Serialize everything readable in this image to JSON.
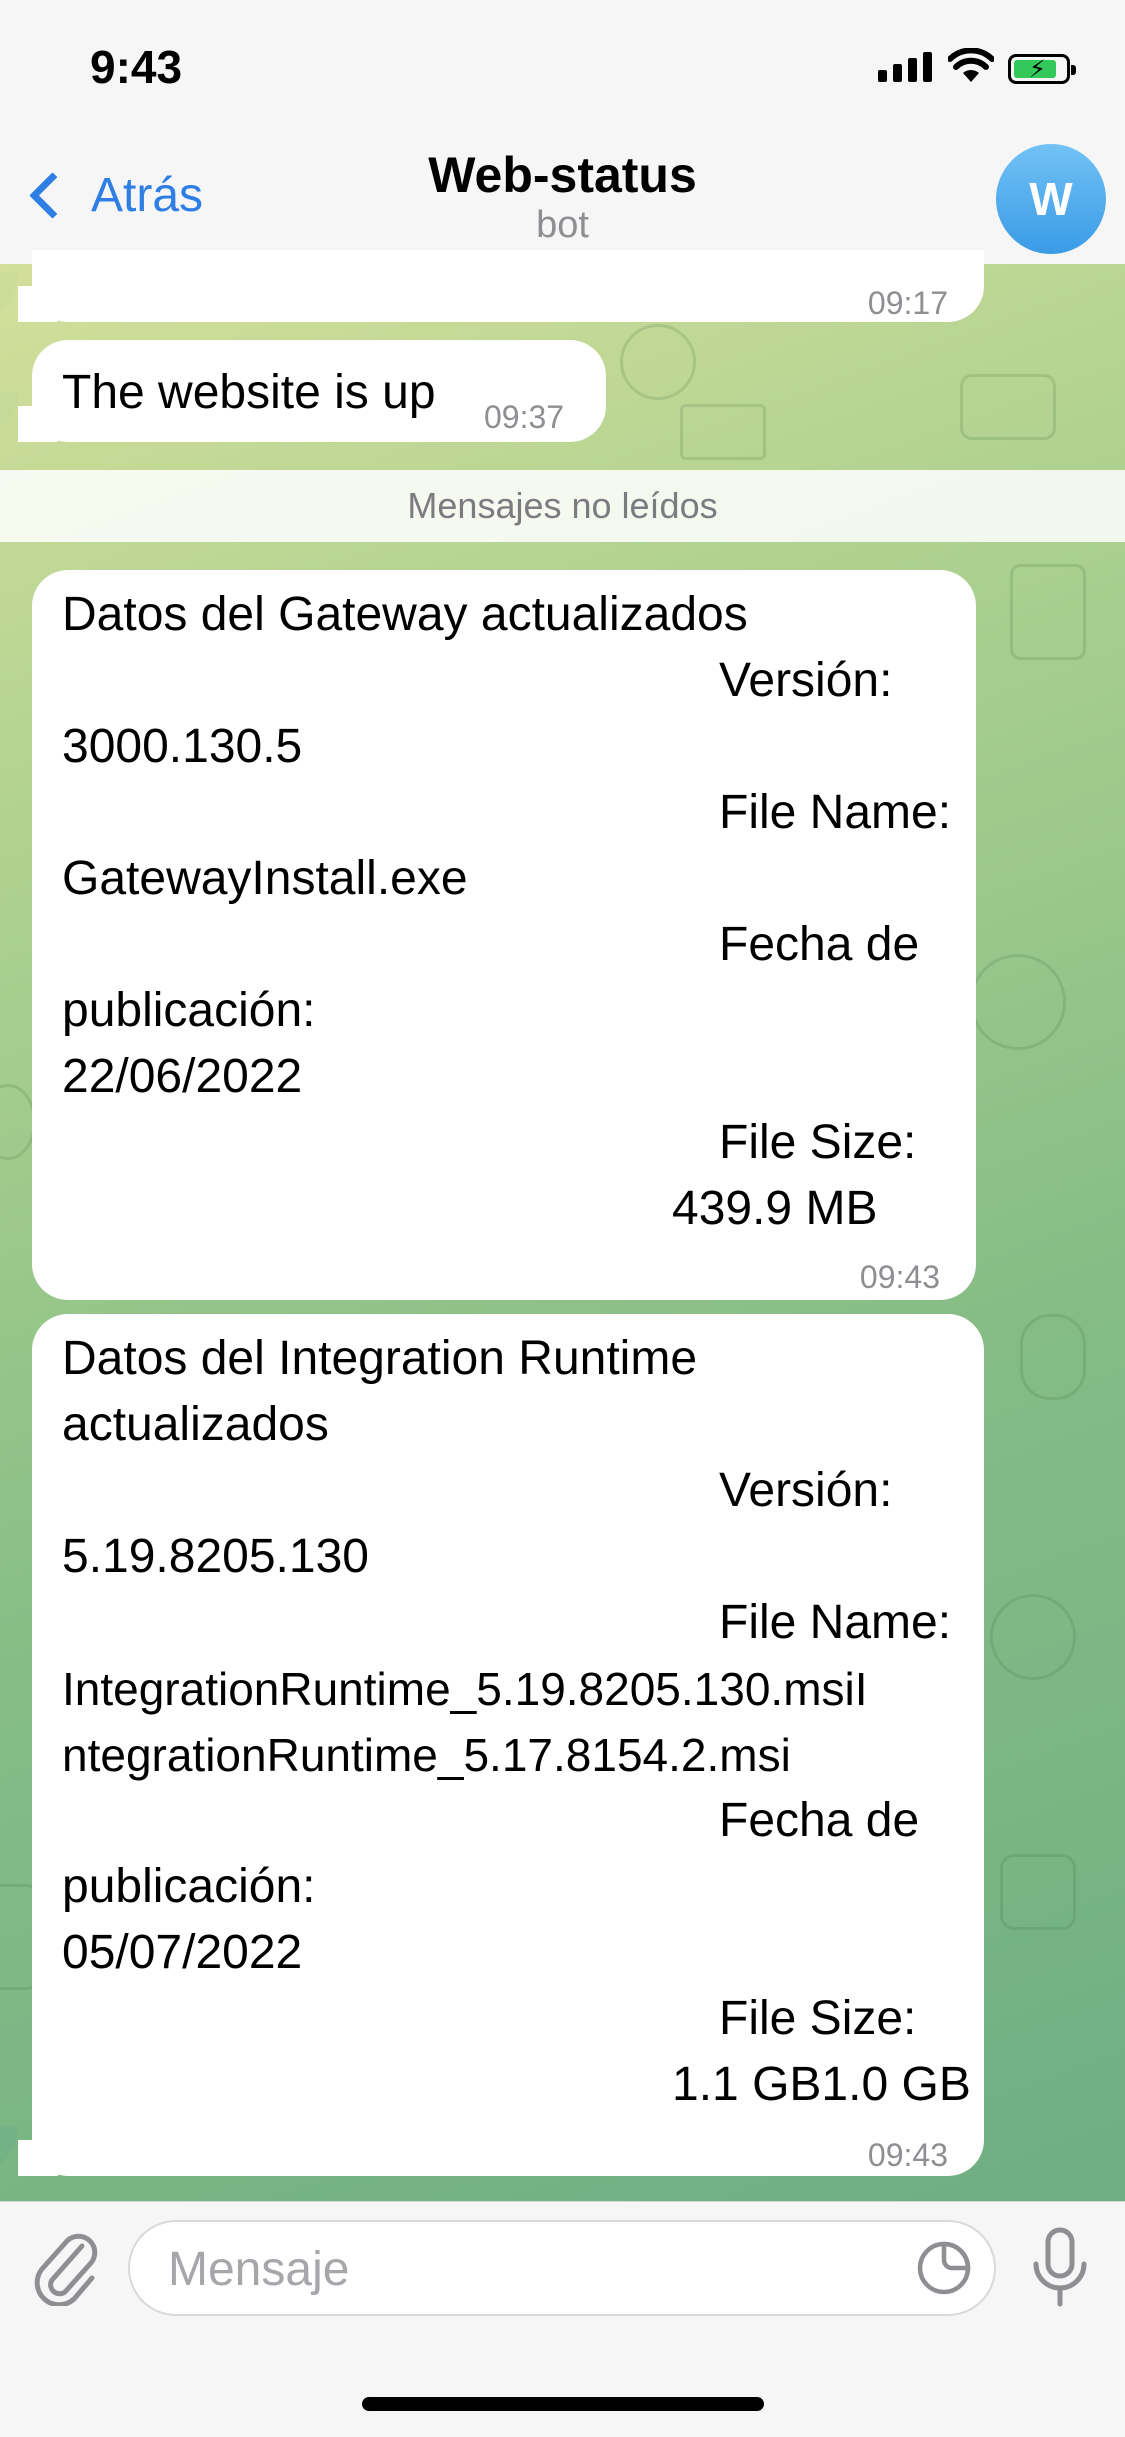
{
  "status_bar": {
    "time": "9:43"
  },
  "nav": {
    "back_label": "Atrás",
    "title": "Web-status",
    "subtitle": "bot",
    "avatar_letter": "W"
  },
  "messages": {
    "prev_time": "09:17",
    "msg1": {
      "text": "The website is up",
      "time": "09:37"
    },
    "unread_label": "Mensajes no leídos",
    "msg2": {
      "lines": [
        "Datos del Gateway actualizados",
        "Versión:",
        "3000.130.5",
        "File Name:",
        "GatewayInstall.exe",
        "Fecha de",
        "publicación:",
        "22/06/2022",
        "File Size:",
        "439.9 MB"
      ],
      "time": "09:43"
    },
    "msg3": {
      "lines": [
        "Datos del Integration Runtime",
        "actualizados",
        "Versión:",
        "5.19.8205.130",
        "File Name:",
        "IntegrationRuntime_5.19.8205.130.msiI",
        "ntegrationRuntime_5.17.8154.2.msi",
        "Fecha de",
        "publicación:",
        "05/07/2022",
        "File Size:",
        "1.1 GB1.0 GB"
      ],
      "time": "09:43"
    }
  },
  "input": {
    "placeholder": "Mensaje"
  },
  "icons": {
    "back": "chevron-left-icon",
    "attach": "paperclip-icon",
    "sticker": "sticker-icon",
    "mic": "microphone-icon"
  },
  "colors": {
    "accent": "#2f7ee4",
    "bubble": "#ffffff",
    "time": "#8e8e93"
  }
}
